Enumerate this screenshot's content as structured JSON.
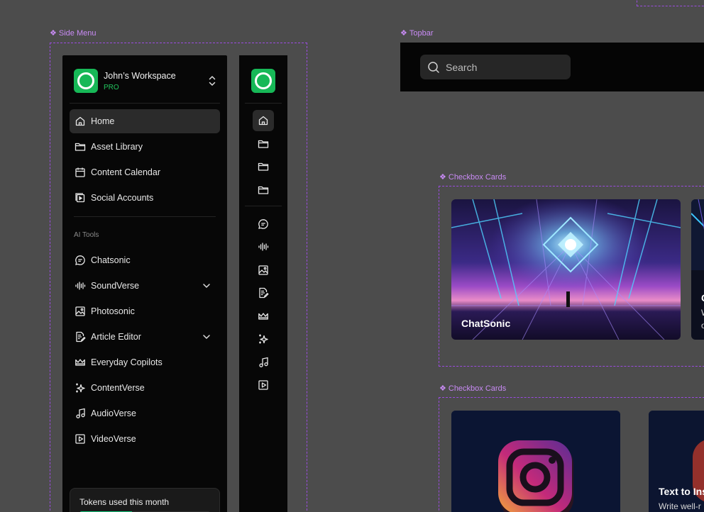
{
  "frames": {
    "side_menu": "Side Menu",
    "topbar": "Topbar",
    "checkbox_cards_1": "Checkbox Cards",
    "checkbox_cards_2": "Checkbox Cards"
  },
  "workspace": {
    "name": "John’s Workspace",
    "plan": "PRO"
  },
  "nav": {
    "home": "Home",
    "asset_library": "Asset Library",
    "content_calendar": "Content Calendar",
    "social_accounts": "Social Accounts"
  },
  "ai_tools": {
    "heading": "AI Tools",
    "chatsonic": "Chatsonic",
    "soundverse": "SoundVerse",
    "photosonic": "Photosonic",
    "article_editor": "Article Editor",
    "everyday_copilots": "Everyday Copilots",
    "contentverse": "ContentVerse",
    "audioverse": "AudioVerse",
    "videoverse": "VideoVerse"
  },
  "tokens": {
    "label": "Tokens used this month",
    "used_fraction": 0.4
  },
  "topbar": {
    "search_placeholder": "Search"
  },
  "cards_row1": {
    "card1_title": "ChatSonic",
    "card2_title": "C",
    "card2_line1": "W",
    "card2_line2": "o"
  },
  "cards_row2": {
    "card2_title": "Text to Ins",
    "card2_sub": "Write well-r"
  },
  "colors": {
    "accent_green": "#17b857",
    "frame_purple": "#9b4be0",
    "token_fill": "#12c57a"
  }
}
